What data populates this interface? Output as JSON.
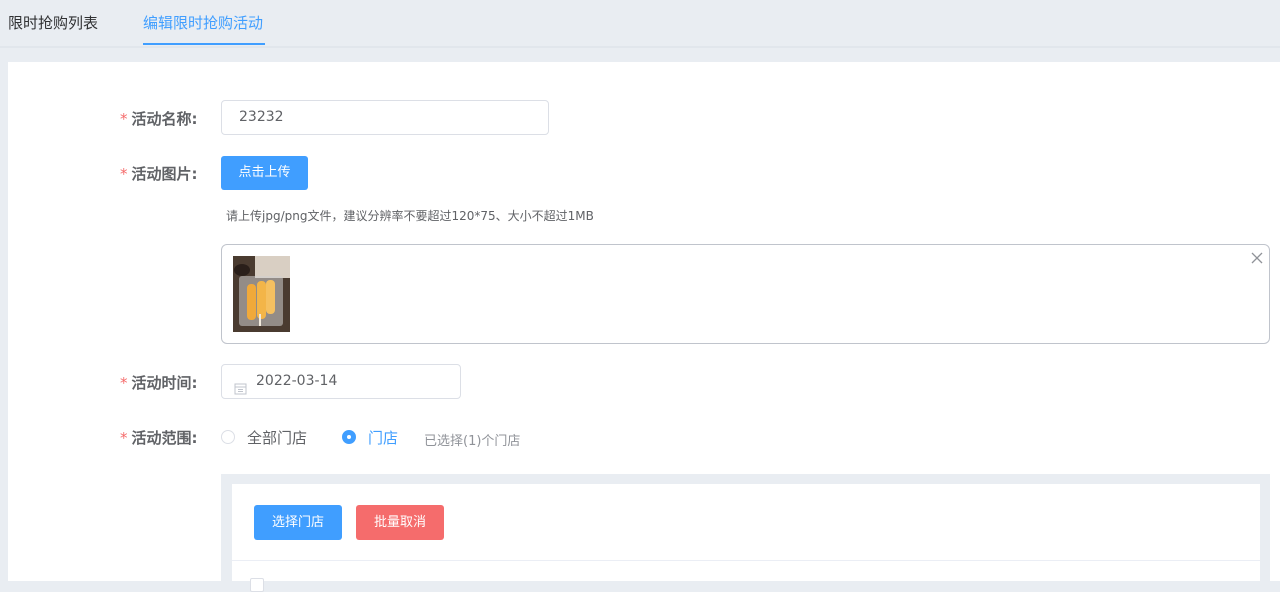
{
  "tabs": [
    {
      "label": "限时抢购列表"
    },
    {
      "label": "编辑限时抢购活动"
    }
  ],
  "form": {
    "name": {
      "label": "活动名称:",
      "value": "23232"
    },
    "image": {
      "label": "活动图片:",
      "upload_label": "点击上传",
      "hint": "请上传jpg/png文件，建议分辨率不要超过120*75、大小不超过1MB"
    },
    "time": {
      "label": "活动时间:",
      "value": "2022-03-14"
    },
    "scope": {
      "label": "活动范围:",
      "option_all": "全部门店",
      "option_store": "门店",
      "selected": "门店",
      "selected_hint": "已选择(1)个门店"
    }
  },
  "store_panel": {
    "select_label": "选择门店",
    "cancel_label": "批量取消"
  },
  "colors": {
    "primary": "#409eff",
    "danger": "#f56c6c",
    "required": "#f56c6c"
  },
  "icons": [
    "close-icon",
    "calendar-icon"
  ]
}
